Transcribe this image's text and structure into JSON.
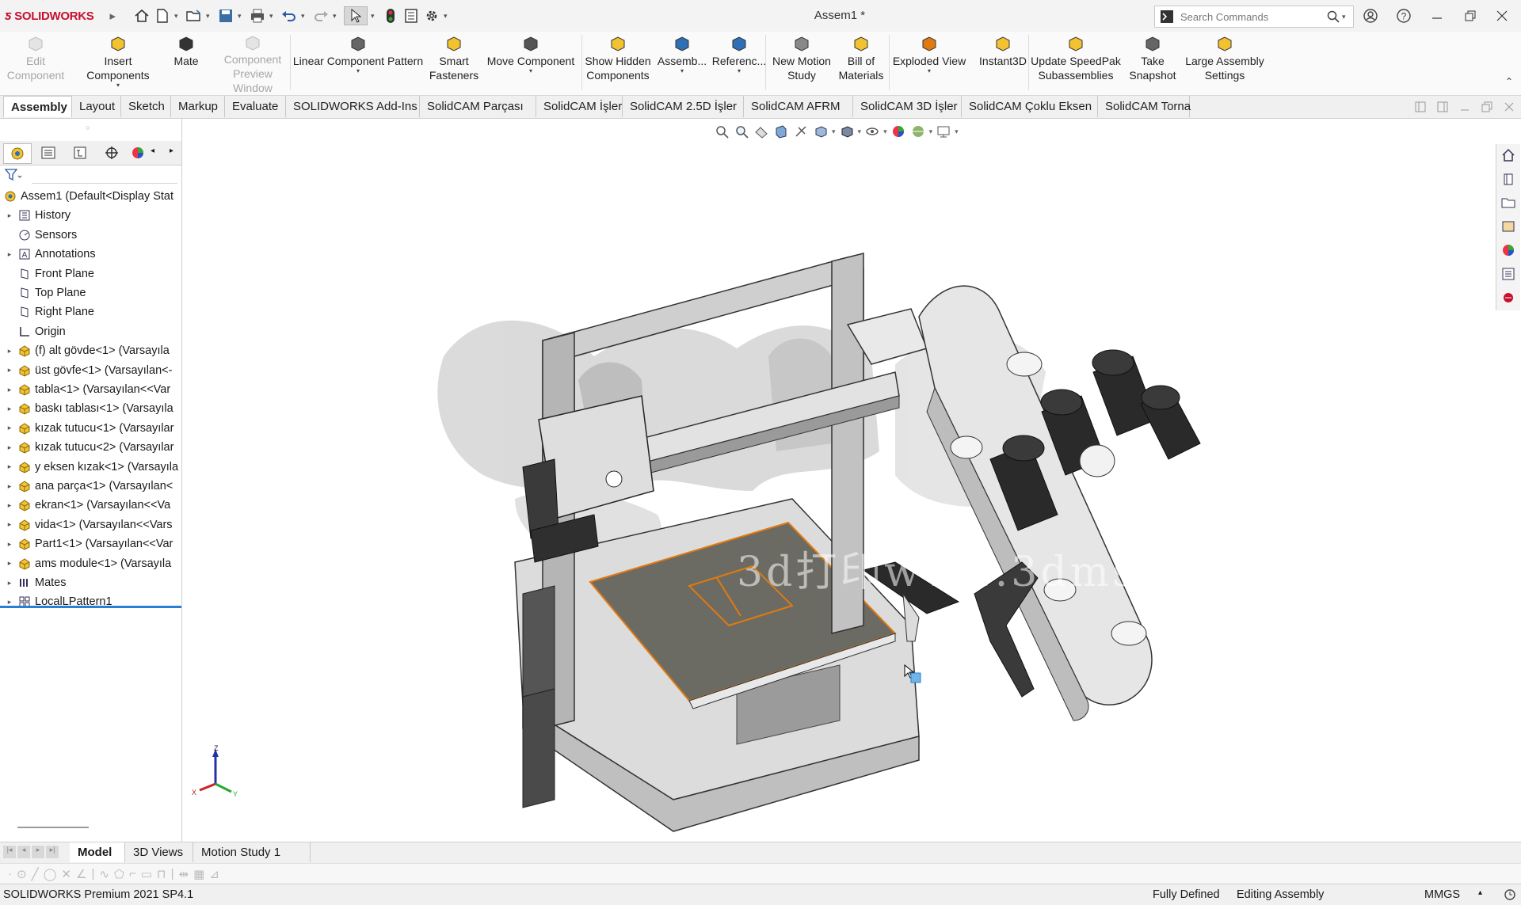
{
  "app": {
    "logo_text": "SOLIDWORKS",
    "doc_title": "Assem1 *",
    "search_placeholder": "Search Commands"
  },
  "commands": [
    {
      "id": "edit-component",
      "label_1": "Edit",
      "label_2": "Component",
      "disabled": true,
      "icon": "edit-component-icon"
    },
    {
      "id": "insert-components",
      "label_1": "Insert Components",
      "label_2": "",
      "disabled": false,
      "icon": "insert-components-icon"
    },
    {
      "id": "mate",
      "label_1": "Mate",
      "label_2": "",
      "disabled": false,
      "icon": "mate-icon"
    },
    {
      "id": "component-preview-window",
      "label_1": "Component",
      "label_2": "Preview Window",
      "disabled": true,
      "icon": "preview-window-icon"
    },
    {
      "id": "linear-component-pattern",
      "label_1": "Linear Component Pattern",
      "label_2": "",
      "disabled": false,
      "icon": "linear-pattern-icon"
    },
    {
      "id": "smart-fasteners",
      "label_1": "Smart",
      "label_2": "Fasteners",
      "disabled": false,
      "icon": "smart-fasteners-icon"
    },
    {
      "id": "move-component",
      "label_1": "Move Component",
      "label_2": "",
      "disabled": false,
      "icon": "move-component-icon"
    },
    {
      "id": "show-hidden-components",
      "label_1": "Show Hidden",
      "label_2": "Components",
      "disabled": false,
      "icon": "show-hidden-icon"
    },
    {
      "id": "assembly",
      "label_1": "Assemb...",
      "label_2": "",
      "disabled": false,
      "icon": "assembly-features-icon"
    },
    {
      "id": "reference",
      "label_1": "Referenc...",
      "label_2": "",
      "disabled": false,
      "icon": "reference-geometry-icon"
    },
    {
      "id": "new-motion-study",
      "label_1": "New Motion",
      "label_2": "Study",
      "disabled": false,
      "icon": "motion-study-icon"
    },
    {
      "id": "bill-of-materials",
      "label_1": "Bill of",
      "label_2": "Materials",
      "disabled": false,
      "icon": "bom-icon"
    },
    {
      "id": "exploded-view",
      "label_1": "Exploded View",
      "label_2": "",
      "disabled": false,
      "icon": "exploded-view-icon"
    },
    {
      "id": "instant3d",
      "label_1": "Instant3D",
      "label_2": "",
      "disabled": false,
      "icon": "instant3d-icon"
    },
    {
      "id": "update-speedpak",
      "label_1": "Update SpeedPak",
      "label_2": "Subassemblies",
      "disabled": false,
      "icon": "speedpak-icon"
    },
    {
      "id": "take-snapshot",
      "label_1": "Take",
      "label_2": "Snapshot",
      "disabled": false,
      "icon": "camera-icon"
    },
    {
      "id": "large-assembly-settings",
      "label_1": "Large Assembly",
      "label_2": "Settings",
      "disabled": false,
      "icon": "large-assembly-icon"
    }
  ],
  "tabs": [
    "Assembly",
    "Layout",
    "Sketch",
    "Markup",
    "Evaluate",
    "SOLIDWORKS Add-Ins",
    "SolidCAM Parçası",
    "SolidCAM İşler",
    "SolidCAM 2.5D İşler",
    "SolidCAM AFRM",
    "SolidCAM 3D İşler",
    "SolidCAM Çoklu Eksen",
    "SolidCAM Torna"
  ],
  "active_tab": "Assembly",
  "tree": [
    {
      "label": "Assem1  (Default<Display Stat",
      "icon": "assembly-icon",
      "expand": false,
      "root": true
    },
    {
      "label": "History",
      "icon": "history-icon",
      "expand": true
    },
    {
      "label": "Sensors",
      "icon": "sensors-icon",
      "expand": false
    },
    {
      "label": "Annotations",
      "icon": "annotations-icon",
      "expand": true
    },
    {
      "label": "Front Plane",
      "icon": "plane-icon",
      "expand": false
    },
    {
      "label": "Top Plane",
      "icon": "plane-icon",
      "expand": false
    },
    {
      "label": "Right Plane",
      "icon": "plane-icon",
      "expand": false
    },
    {
      "label": "Origin",
      "icon": "origin-icon",
      "expand": false
    },
    {
      "label": "(f) alt gövde<1> (Varsayıla",
      "icon": "part-icon",
      "expand": true
    },
    {
      "label": "üst gövfe<1> (Varsayılan<-",
      "icon": "part-icon",
      "expand": true
    },
    {
      "label": "tabla<1> (Varsayılan<<Var",
      "icon": "part-icon",
      "expand": true
    },
    {
      "label": "baskı tablası<1> (Varsayıla",
      "icon": "part-icon",
      "expand": true
    },
    {
      "label": "kızak tutucu<1> (Varsayılar",
      "icon": "part-icon",
      "expand": true
    },
    {
      "label": "kızak tutucu<2> (Varsayılar",
      "icon": "part-icon",
      "expand": true
    },
    {
      "label": "y eksen kızak<1> (Varsayıla",
      "icon": "part-icon",
      "expand": true
    },
    {
      "label": "ana parça<1> (Varsayılan<",
      "icon": "part-icon",
      "expand": true
    },
    {
      "label": "ekran<1> (Varsayılan<<Va",
      "icon": "part-icon",
      "expand": true
    },
    {
      "label": "vida<1> (Varsayılan<<Vars",
      "icon": "part-icon",
      "expand": true
    },
    {
      "label": "Part1<1> (Varsayılan<<Var",
      "icon": "part-icon",
      "expand": true
    },
    {
      "label": "ams module<1> (Varsayıla",
      "icon": "part-icon",
      "expand": true
    },
    {
      "label": "Mates",
      "icon": "mates-icon",
      "expand": true
    },
    {
      "label": "LocalLPattern1",
      "icon": "pattern-icon",
      "expand": true
    }
  ],
  "triad": {
    "z": "Z",
    "x": "X",
    "y": "Y"
  },
  "watermark": "3d打印www.3dmss.com",
  "bottom_tabs": [
    "Model",
    "3D Views",
    "Motion Study 1"
  ],
  "active_bottom_tab": "Model",
  "status": {
    "product": "SOLIDWORKS Premium 2021 SP4.1",
    "defined": "Fully Defined",
    "mode": "Editing Assembly",
    "units": "MMGS"
  },
  "colors": {
    "accent": "#2a7fd4",
    "brand": "#c8102e",
    "plate": "#6b6b63",
    "plate_edge": "#e07a10"
  }
}
